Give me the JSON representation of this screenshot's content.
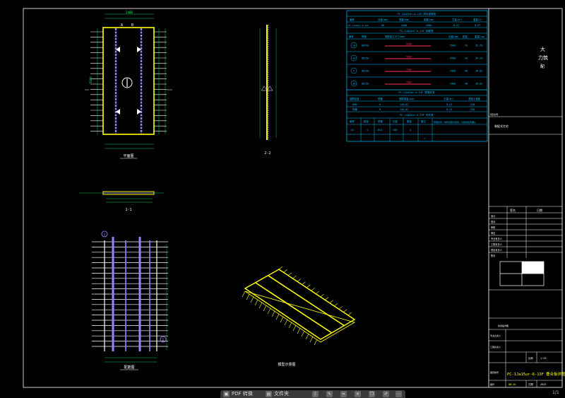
{
  "colors": {
    "bg": "#000000",
    "frame": "#ffffff",
    "slab": "#ffff00",
    "rebar": "#9b82ff",
    "dim": "#00ff66",
    "table": "#00bfff",
    "red": "#ff3060",
    "white": "#ffffff"
  },
  "drawing": {
    "plan_title": "平面图",
    "section_2_2": "2-2",
    "section_1_1": "1-1",
    "rebar_title": "配筋图",
    "iso_title": "模型示意图",
    "plan_dim_width": "2400",
    "plan_dim_length": "5900",
    "plan_dim_half": "1/2",
    "mark_circle_1": "1",
    "mark_circle_2": "2",
    "mark_a": "A",
    "mark_b": "B"
  },
  "tables": {
    "t1": {
      "title": "PC-1Ja15ur-6-13F 构件参数表",
      "headers": [
        "编号",
        "长度(mm)",
        "宽度(mm)",
        "厚度(mm)",
        "方量(m³)",
        "重量(t)"
      ],
      "row": [
        "PC-1Ja15ur-6-13F",
        "60",
        "2400",
        "5900",
        "0.23",
        "0.57"
      ]
    },
    "t2": {
      "title": "PC-1Ja15ur-6-13F 钢筋表",
      "headers": [
        "编号",
        "规格",
        "钢筋加工尺寸(mm)",
        "长度(mm)",
        "数量",
        "重量(kg)"
      ],
      "rows": [
        {
          "id": "1a",
          "spec": "8@150",
          "len": "5900",
          "num": "16",
          "wt": "35.29"
        },
        {
          "id": "2a",
          "spec": "8@150",
          "len": "5900",
          "num": "16",
          "wt": "35.29"
        },
        {
          "id": "3",
          "spec": "8@150",
          "len": "2400",
          "num": "40",
          "wt": "38.02"
        },
        {
          "id": "3b",
          "spec": "8@150",
          "len": "2400",
          "num": "40",
          "wt": "38.02"
        }
      ]
    },
    "t3": {
      "title": "PC-1Ja15ur-6-13F 预埋件表",
      "headers": [
        "钢筋总重",
        "规格",
        "钢筋重量(kg)",
        "方量(m³)",
        "混凝土强度"
      ],
      "rows": [
        [
          "HRB",
          "8",
          "146.62",
          "0.23",
          "C30"
        ],
        [
          "规格",
          "8",
          "146.62",
          "0.23",
          "C30"
        ]
      ]
    },
    "t4": {
      "title": "PC-1Ja15ur-6-13F 吊件表",
      "headers": [
        "编号",
        "数量",
        "规格",
        "长度",
        "数量",
        "备注"
      ],
      "row": [
        "DJ",
        "4",
        "Φ14",
        "300",
        "4",
        "预埋吊件，构件吊装时使用，吊装前检查确认",
        "1"
      ]
    }
  },
  "titleblock": {
    "company_line1": "大",
    "company_line2": "力筑",
    "company_line3": "配",
    "project_label": "项目名称",
    "project_name": "装配式住宅",
    "rows": [
      {
        "l": "设计",
        "r": ""
      },
      {
        "l": "校对",
        "r": ""
      },
      {
        "l": "审核",
        "r": ""
      },
      {
        "l": "审定",
        "r": ""
      },
      {
        "l": "专业负责人",
        "r": ""
      },
      {
        "l": "工程负责人",
        "r": ""
      },
      {
        "l": "项目负责人",
        "r": ""
      },
      {
        "l": "院长",
        "r": ""
      }
    ],
    "head_left": "签名",
    "head_right": "日期",
    "sheet_name": "叠合板详图",
    "scale_label": "比例",
    "scale": "1:25",
    "drawing_no_label": "图纸编号",
    "drawing_no": "PC-1Ja15ur-6-13F 叠合板详图",
    "date_label": "日期",
    "date": "2023",
    "sheet_label": "图号",
    "sheet": "DB-01"
  },
  "taskbar": {
    "item1": "PDF 转换",
    "item2": "文件夹"
  },
  "page_number": "1/1"
}
